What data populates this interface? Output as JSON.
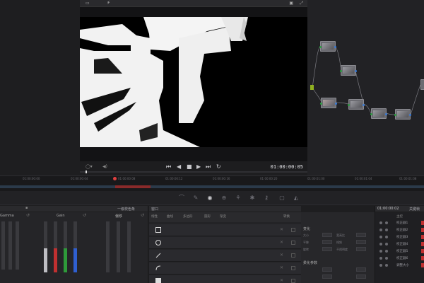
{
  "viewer": {
    "timecode": "01:00:00:05",
    "transport": [
      "⏮",
      "◀",
      "■",
      "▶",
      "⏭",
      "↻"
    ]
  },
  "timeline": {
    "ticks": [
      "01:00:00:00",
      "01:00:00:04",
      "01:00:00:08",
      "01:00:00:12",
      "01:00:00:16",
      "01:00:00:20",
      "01:00:01:00",
      "01:00:01:04",
      "01:00:01:08"
    ]
  },
  "wheels_panel": {
    "title": "一级校色条",
    "labels": [
      "Gamma",
      "Gain",
      "偏移"
    ]
  },
  "window_panel": {
    "title": "窗口",
    "tools": [
      "线性",
      "曲线",
      "多边形",
      "圆形",
      "渐变"
    ],
    "right_label": "转换"
  },
  "transform_panel": {
    "section1": "变化",
    "section2": "柔化参数",
    "labels": [
      "大小",
      "宽高比",
      "平移",
      "倾斜",
      "旋转",
      "不透明度"
    ]
  },
  "keyframes": {
    "timecode": "01:00:00:02",
    "title": "关键帧",
    "header": "主控",
    "rows": [
      "校正器1",
      "校正器2",
      "校正器3",
      "校正器4",
      "校正器5",
      "校正器6",
      "调整大小"
    ]
  }
}
